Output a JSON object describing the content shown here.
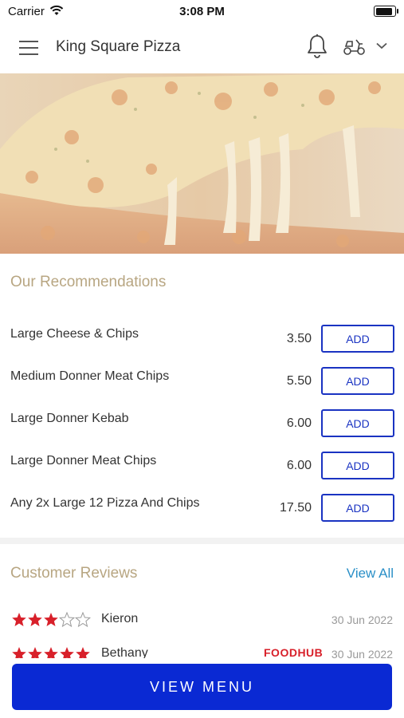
{
  "status_bar": {
    "carrier": "Carrier",
    "time": "3:08 PM"
  },
  "header": {
    "title": "King Square Pizza"
  },
  "icons": [
    "menu-icon",
    "bell-icon",
    "scooter-icon",
    "chevron-down-icon",
    "wifi-icon",
    "battery-icon",
    "star-icon"
  ],
  "recommendations": {
    "title": "Our Recommendations",
    "items": [
      {
        "name": "Large Cheese & Chips",
        "price": "3.50",
        "button": "ADD"
      },
      {
        "name": "Medium Donner Meat Chips",
        "price": "5.50",
        "button": "ADD"
      },
      {
        "name": "Large Donner Kebab",
        "price": "6.00",
        "button": "ADD"
      },
      {
        "name": "Large Donner Meat Chips",
        "price": "6.00",
        "button": "ADD"
      },
      {
        "name": "Any 2x Large 12 Pizza And Chips",
        "price": "17.50",
        "button": "ADD"
      }
    ]
  },
  "reviews": {
    "title": "Customer Reviews",
    "view_all": "View All",
    "items": [
      {
        "name": "Kieron",
        "rating": 3,
        "date": "30 Jun 2022",
        "source": ""
      },
      {
        "name": "Bethany",
        "rating": 5,
        "date": "30 Jun 2022",
        "source": "FOODHUB"
      }
    ]
  },
  "colors": {
    "accent": "#0a29d3",
    "add_button": "#1a33c2",
    "section_title": "#b8a682",
    "link": "#2a8fc7",
    "star": "#d8202a"
  },
  "bottom": {
    "view_menu": "VIEW MENU"
  }
}
